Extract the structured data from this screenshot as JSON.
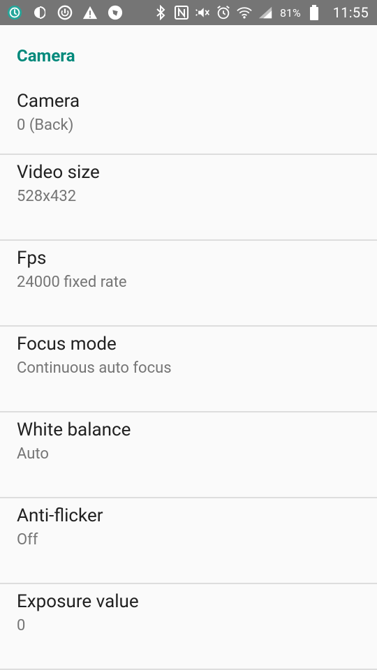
{
  "status_bar": {
    "battery_percent": "81%",
    "time": "11:55",
    "background_color": "#757575",
    "icons_left": [
      "app-circle-icon",
      "half-circle-icon",
      "power-circle-icon",
      "warning-icon",
      "shield-icon"
    ],
    "icons_right": [
      "bluetooth-icon",
      "nfc-icon",
      "mute-icon",
      "alarm-icon",
      "wifi-icon",
      "signal-icon",
      "battery-icon"
    ]
  },
  "settings": {
    "category_title": "Camera",
    "accent_color": "#00897b",
    "items": [
      {
        "title": "Camera",
        "summary": "0 (Back)"
      },
      {
        "title": "Video size",
        "summary": "528x432"
      },
      {
        "title": "Fps",
        "summary": "24000 fixed rate"
      },
      {
        "title": "Focus mode",
        "summary": "Continuous auto focus"
      },
      {
        "title": "White balance",
        "summary": "Auto"
      },
      {
        "title": "Anti-flicker",
        "summary": "Off"
      },
      {
        "title": "Exposure value",
        "summary": "0"
      }
    ]
  }
}
